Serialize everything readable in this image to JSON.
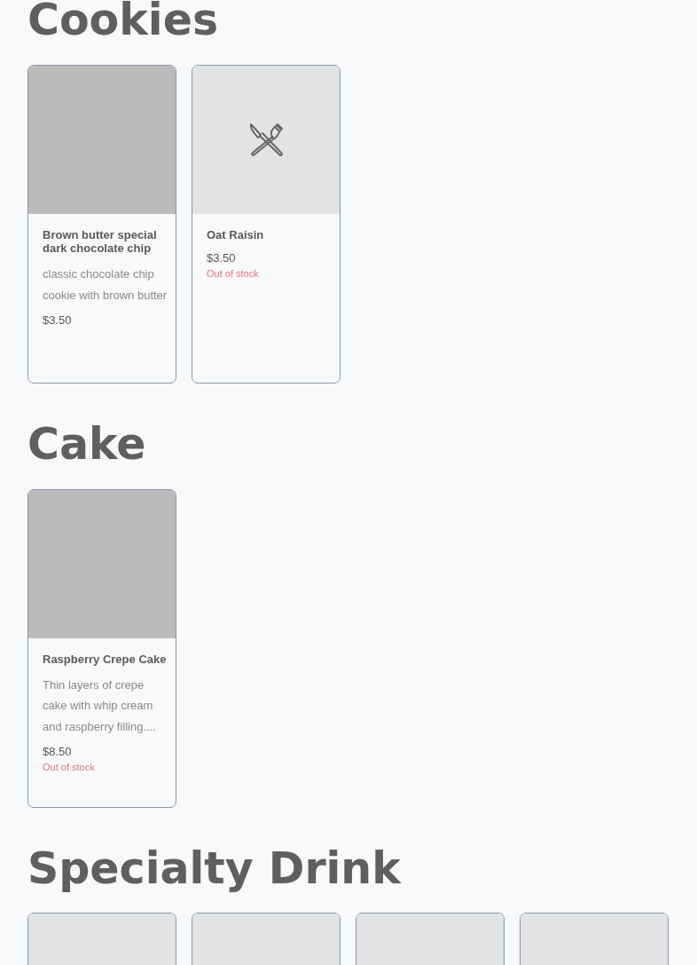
{
  "sections": [
    {
      "title": "Cookies",
      "items": [
        {
          "kind": "photo",
          "name": "Brown butter special dark chocolate chip",
          "description": "classic chocolate chip cookie with brown butter",
          "price": "$3.50"
        },
        {
          "kind": "placeholder",
          "name": "Oat Raisin",
          "price": "$3.50",
          "stock_note": "Out of stock"
        }
      ]
    },
    {
      "title": "Cake",
      "items": [
        {
          "kind": "photo",
          "name": "Raspberry Crepe Cake",
          "description": "Thin layers of crepe cake with whip cream and raspberry filling....",
          "price": "$8.50",
          "stock_note": "Out of stock"
        }
      ]
    },
    {
      "title": "Specialty Drink",
      "items": [
        {
          "kind": "blank"
        },
        {
          "kind": "blank"
        },
        {
          "kind": "blank"
        },
        {
          "kind": "blank"
        }
      ]
    }
  ]
}
